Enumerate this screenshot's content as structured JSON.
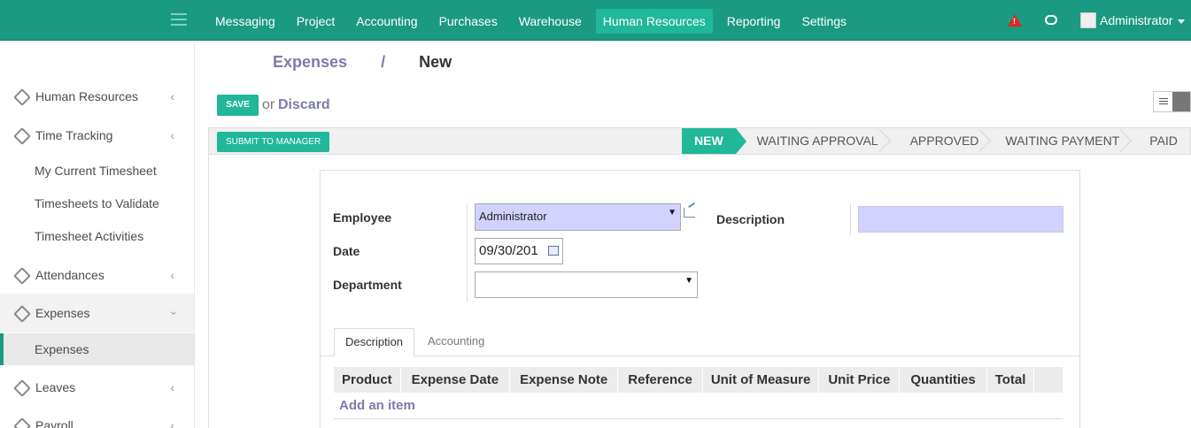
{
  "topbar": {
    "menu": [
      "Messaging",
      "Project",
      "Accounting",
      "Purchases",
      "Warehouse",
      "Human Resources",
      "Reporting",
      "Settings"
    ],
    "active_menu": "Human Resources",
    "user": "Administrator",
    "accent_color": "#1a9a80"
  },
  "sidebar": {
    "human_resources": "Human Resources",
    "time_tracking": "Time Tracking",
    "my_current_timesheet": "My Current Timesheet",
    "timesheets_to_validate": "Timesheets to Validate",
    "timesheet_activities": "Timesheet Activities",
    "attendances": "Attendances",
    "expenses_group": "Expenses",
    "expenses": "Expenses",
    "leaves": "Leaves",
    "payroll": "Payroll"
  },
  "breadcrumb": {
    "parent": "Expenses",
    "separator": "/",
    "current": "New"
  },
  "actions": {
    "save": "SAVE",
    "or": "or",
    "discard": "Discard"
  },
  "statusbar": {
    "submit": "SUBMIT TO MANAGER",
    "stages": [
      "NEW",
      "WAITING APPROVAL",
      "APPROVED",
      "WAITING PAYMENT",
      "PAID"
    ],
    "current_stage": "NEW"
  },
  "form": {
    "employee_label": "Employee",
    "employee_value": "Administrator",
    "date_label": "Date",
    "date_value": "09/30/201",
    "department_label": "Department",
    "department_value": "",
    "description_label": "Description",
    "description_value": ""
  },
  "tabs": {
    "description": "Description",
    "accounting": "Accounting"
  },
  "table": {
    "columns": [
      "Product",
      "Expense Date",
      "Expense Note",
      "Reference",
      "Unit of Measure",
      "Unit Price",
      "Quantities",
      "Total"
    ],
    "add_item": "Add an item"
  }
}
